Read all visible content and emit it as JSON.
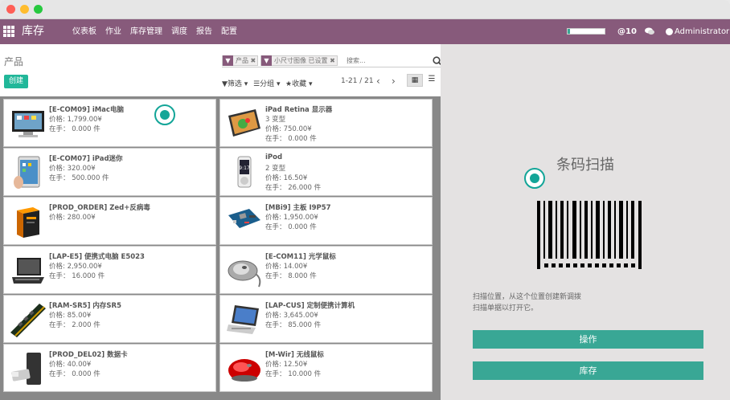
{
  "window": {
    "dots": [
      "#ff5f56",
      "#ffbd2e",
      "#27c93f"
    ]
  },
  "nav": {
    "app_title": "库存",
    "menu": [
      "仪表板",
      "作业",
      "库存管理",
      "调度",
      "报告",
      "配置"
    ],
    "messages_count": "10",
    "user": "Administrator",
    "color": "#875a7b"
  },
  "breadcrumb": "产品",
  "create_label": "创建",
  "search": {
    "facets": [
      {
        "label": "产品"
      },
      {
        "label": "小尺寸图像 已设置"
      }
    ],
    "placeholder": "搜索..."
  },
  "options": {
    "filters": "筛选",
    "groupby": "分组",
    "favorites": "收藏"
  },
  "pager": "1-21 / 21",
  "products": [
    {
      "name": "[E-COM09] iMac电脑",
      "lines": [
        "价格: 1,799.00¥",
        "在手：  0.000 件"
      ],
      "icon": "imac"
    },
    {
      "name": "iPad Retina 显示器",
      "lines": [
        "3 变型",
        "价格: 750.00¥",
        "在手：  0.000 件"
      ],
      "icon": "ipad-retina"
    },
    {
      "name": "[E-COM07] iPad迷你",
      "lines": [
        "价格: 320.00¥",
        "在手：  500.000 件"
      ],
      "icon": "ipad-mini"
    },
    {
      "name": "iPod",
      "lines": [
        "2 变型",
        "价格: 16.50¥",
        "在手：  26.000 件"
      ],
      "icon": "ipod"
    },
    {
      "name": "[PROD_ORDER] Zed+反病毒",
      "lines": [
        "价格: 280.00¥"
      ],
      "icon": "software-box"
    },
    {
      "name": "[MBi9] 主板 I9P57",
      "lines": [
        "价格: 1,950.00¥",
        "在手：  0.000 件"
      ],
      "icon": "motherboard"
    },
    {
      "name": "[LAP-E5] 便携式电脑 E5023",
      "lines": [
        "价格: 2,950.00¥",
        "在手：  16.000 件"
      ],
      "icon": "laptop"
    },
    {
      "name": "[E-COM11] 光学鼠标",
      "lines": [
        "价格: 14.00¥",
        "在手：  8.000 件"
      ],
      "icon": "mouse"
    },
    {
      "name": "[RAM-SR5] 内存SR5",
      "lines": [
        "价格: 85.00¥",
        "在手：  2.000 件"
      ],
      "icon": "ram"
    },
    {
      "name": "[LAP-CUS] 定制便携计算机",
      "lines": [
        "价格: 3,645.00¥",
        "在手：  85.000 件"
      ],
      "icon": "laptop-custom"
    },
    {
      "name": "[PROD_DEL02] 数据卡",
      "lines": [
        "价格: 40.00¥",
        "在手：  0.000 件"
      ],
      "icon": "usb-stick"
    },
    {
      "name": "[M-Wir] 无线鼠标",
      "lines": [
        "价格: 12.50¥",
        "在手：  10.000 件"
      ],
      "icon": "wireless-mouse"
    }
  ],
  "barcode_panel": {
    "title": "条码扫描",
    "hint_line1": "扫描位置，从这个位置创建新调拨",
    "hint_line2": "扫描单据以打开它。",
    "btn_operations": "操作",
    "btn_inventory": "库存",
    "accent": "#39a795"
  }
}
